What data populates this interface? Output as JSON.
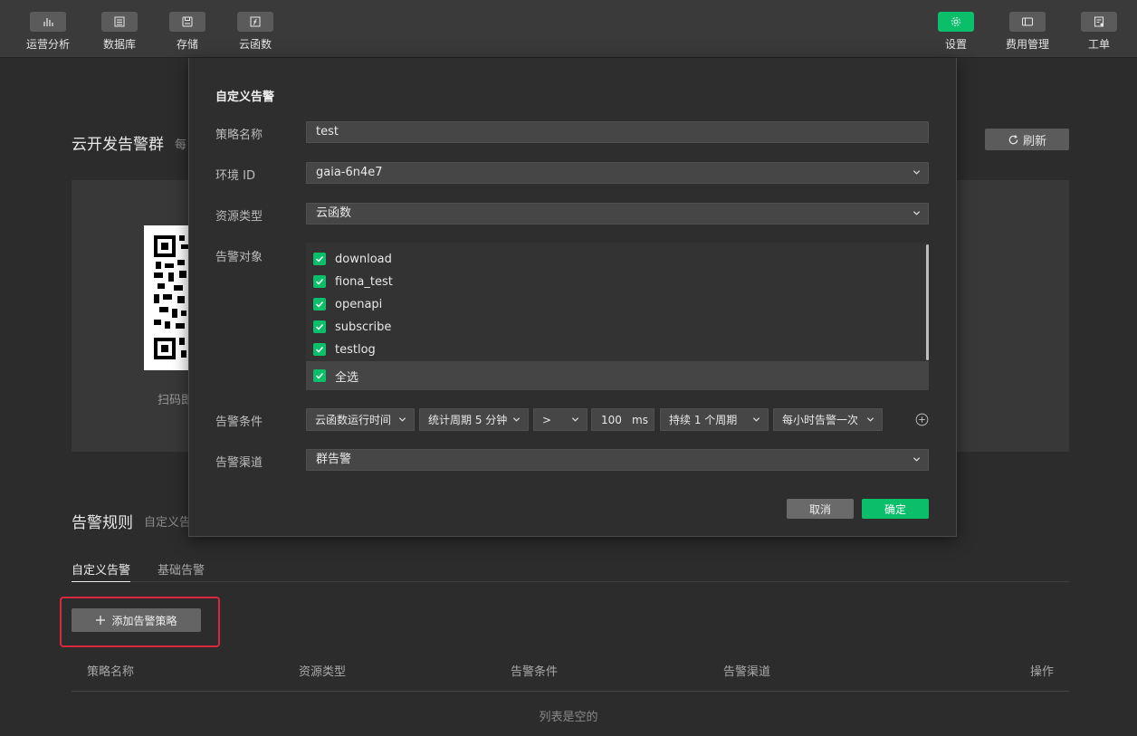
{
  "toolbar": {
    "left_items": [
      {
        "label": "运营分析",
        "icon": "bar-chart-icon"
      },
      {
        "label": "数据库",
        "icon": "database-icon"
      },
      {
        "label": "存储",
        "icon": "storage-icon"
      },
      {
        "label": "云函数",
        "icon": "function-icon"
      }
    ],
    "right_items": [
      {
        "label": "设置",
        "icon": "gear-icon",
        "active": true
      },
      {
        "label": "费用管理",
        "icon": "billing-icon"
      },
      {
        "label": "工单",
        "icon": "ticket-icon"
      }
    ]
  },
  "page": {
    "alert_group_title": "云开发告警群",
    "alert_group_sub": "每",
    "refresh_label": "刷新",
    "qr_caption": "扫码即",
    "rules_title": "告警规则",
    "rules_sub": "自定义告",
    "tabs": [
      {
        "label": "自定义告警",
        "active": true
      },
      {
        "label": "基础告警",
        "active": false
      }
    ],
    "add_button_label": "添加告警策略",
    "table_headers": [
      "策略名称",
      "资源类型",
      "告警条件",
      "告警渠道",
      "操作"
    ],
    "empty_text": "列表是空的"
  },
  "modal": {
    "title": "自定义告警",
    "policy_name_label": "策略名称",
    "policy_name_value": "test",
    "env_label": "环境 ID",
    "env_value": "gaia-6n4e7",
    "resource_type_label": "资源类型",
    "resource_type_value": "云函数",
    "targets_label": "告警对象",
    "targets": [
      "download",
      "fiona_test",
      "openapi",
      "subscribe",
      "testlog"
    ],
    "select_all_label": "全选",
    "conditions_label": "告警条件",
    "conditions": {
      "metric": "云函数运行时间",
      "period": "统计周期 5 分钟",
      "operator": ">",
      "threshold": "100",
      "unit": "ms",
      "duration": "持续 1 个周期",
      "frequency": "每小时告警一次"
    },
    "channel_label": "告警渠道",
    "channel_value": "群告警",
    "cancel_label": "取消",
    "confirm_label": "确定"
  },
  "colors": {
    "accent_green": "#0bbf6a",
    "highlight_red": "#d9273d",
    "background": "#2c2c2c"
  }
}
